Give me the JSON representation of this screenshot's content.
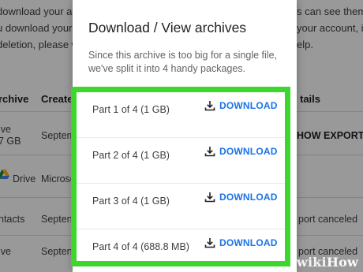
{
  "background": {
    "intro_lines": [
      "download your arc",
      "u download your",
      "deletion, please w"
    ],
    "right_snippets": [
      "s can see them,",
      "your account, includ",
      "elp."
    ],
    "columns": {
      "archive": "rchive",
      "created": "Create",
      "details": "tails"
    },
    "rows": [
      {
        "name_1": "ive",
        "name_2": "7 GB",
        "created": "Septem",
        "details": "HOW EXPORTS"
      },
      {
        "name_1": "Drive",
        "name_2": "",
        "created": "Microso",
        "details": ""
      },
      {
        "name_1": "ntacts",
        "name_2": "",
        "created": "Septen",
        "details": "port canceled"
      },
      {
        "name_1": "ive",
        "name_2": "",
        "created": "Septen",
        "details": "port canceled"
      }
    ]
  },
  "dialog": {
    "title": "Download / View archives",
    "description_lines": [
      "Since this archive is too big for a single file,",
      "we've split it into 4 handy packages."
    ],
    "parts": [
      {
        "label": "Part 1 of 4 (1 GB)",
        "action": "DOWNLOAD",
        "icon": "download-icon"
      },
      {
        "label": "Part 2 of 4 (1 GB)",
        "action": "DOWNLOAD",
        "icon": "download-icon"
      },
      {
        "label": "Part 3 of 4 (1 GB)",
        "action": "DOWNLOAD",
        "icon": "download-icon"
      },
      {
        "label": "Part 4 of 4 (688.8 MB)",
        "action": "DOWNLOAD",
        "icon": "download-icon"
      }
    ]
  },
  "colors": {
    "highlight": "#3dd62c",
    "link": "#1a73e8",
    "scrim": "rgba(0,0,0,0.40)"
  },
  "watermark": {
    "wiki": "wiki",
    "how": "How"
  }
}
